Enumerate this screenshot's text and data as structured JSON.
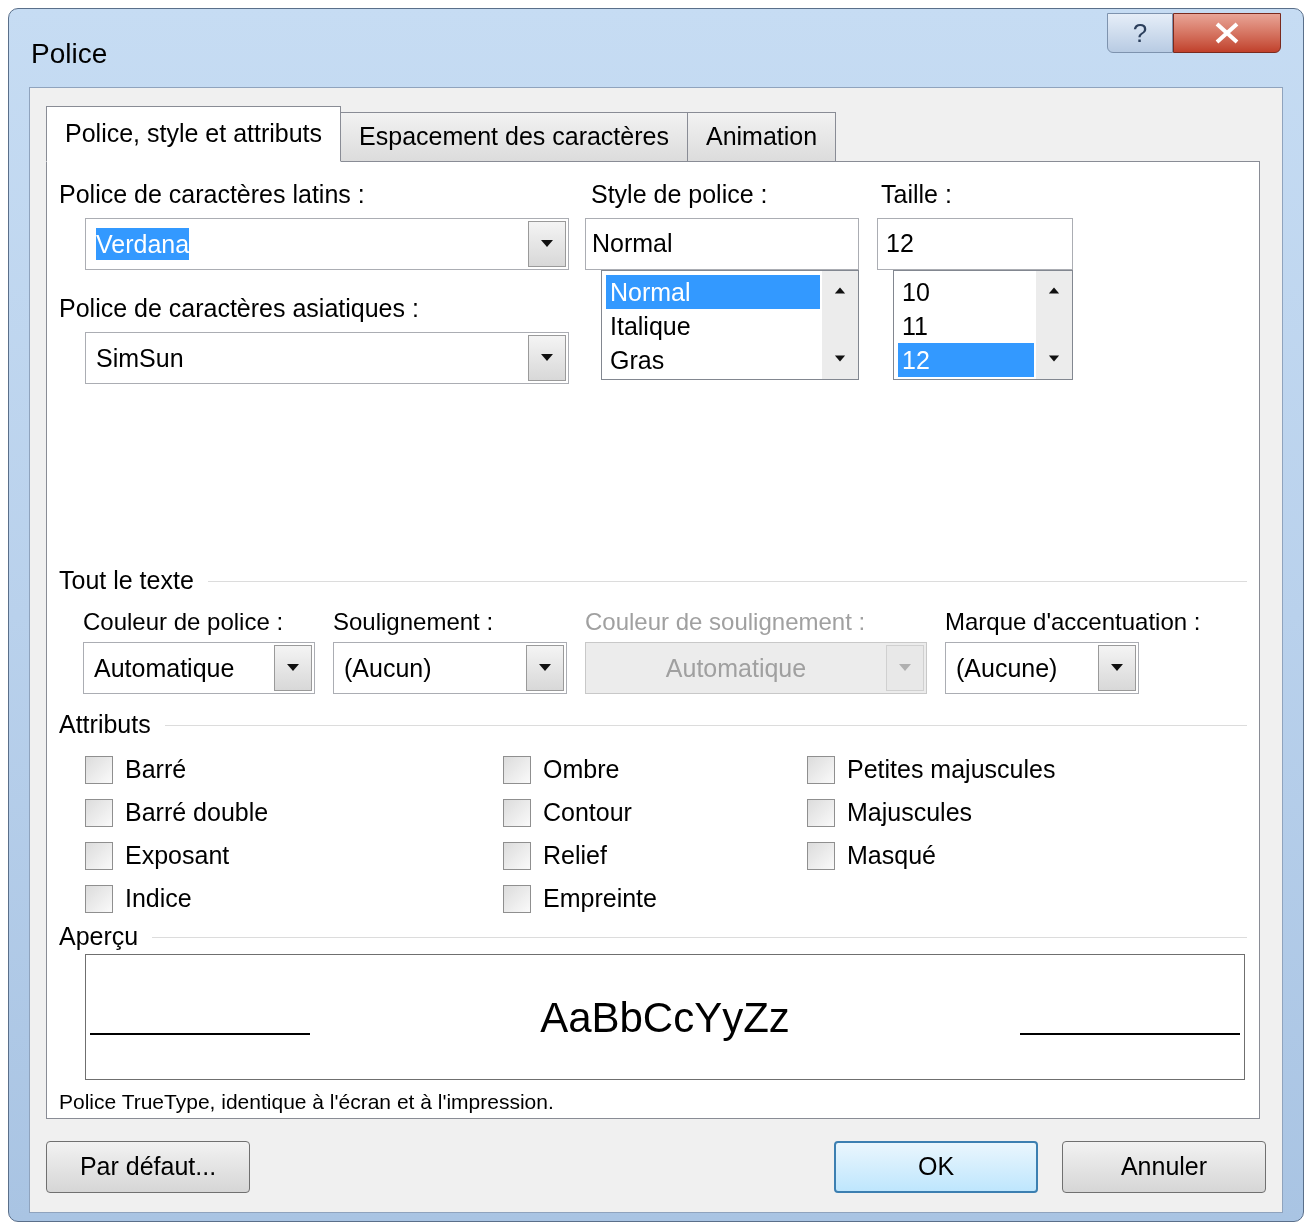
{
  "window": {
    "title": "Police",
    "help_label": "?"
  },
  "tabs": [
    {
      "label": "Police, style et attributs",
      "selected": true
    },
    {
      "label": "Espacement des caractères",
      "selected": false
    },
    {
      "label": "Animation",
      "selected": false
    }
  ],
  "latin_font": {
    "label": "Police de caractères latins :",
    "value": "Verdana",
    "highlighted": true
  },
  "asian_font": {
    "label": "Police de caractères asiatiques :",
    "value": "SimSun",
    "highlighted": false
  },
  "font_style": {
    "label": "Style de police :",
    "value": "Normal",
    "options": [
      {
        "label": "Normal",
        "selected": true
      },
      {
        "label": "Italique",
        "selected": false
      },
      {
        "label": "Gras",
        "selected": false
      }
    ]
  },
  "size": {
    "label": "Taille :",
    "value": "12",
    "options": [
      {
        "label": "10",
        "selected": false
      },
      {
        "label": "11",
        "selected": false
      },
      {
        "label": "12",
        "selected": true
      }
    ]
  },
  "all_text": {
    "title": "Tout le texte",
    "controls": [
      {
        "label": "Couleur de police :",
        "value": "Automatique",
        "disabled": false
      },
      {
        "label": "Soulignement :",
        "value": "(Aucun)",
        "disabled": false
      },
      {
        "label": "Couleur de soulignement :",
        "value": "Automatique",
        "disabled": true
      },
      {
        "label": "Marque d'accentuation :",
        "value": "(Aucune)",
        "disabled": false
      }
    ]
  },
  "attributes": {
    "title": "Attributs",
    "columns": [
      [
        {
          "label": "Barré",
          "checked": false
        },
        {
          "label": "Barré double",
          "checked": false
        },
        {
          "label": "Exposant",
          "checked": false
        },
        {
          "label": "Indice",
          "checked": false
        }
      ],
      [
        {
          "label": "Ombre",
          "checked": false
        },
        {
          "label": "Contour",
          "checked": false
        },
        {
          "label": "Relief",
          "checked": false
        },
        {
          "label": "Empreinte",
          "checked": false
        }
      ],
      [
        {
          "label": "Petites majuscules",
          "checked": false
        },
        {
          "label": "Majuscules",
          "checked": false
        },
        {
          "label": "Masqué",
          "checked": false
        }
      ]
    ]
  },
  "preview": {
    "title": "Aperçu",
    "sample": "AaBbCcYyZz",
    "note": "Police TrueType, identique à l'écran et à l'impression."
  },
  "buttons": [
    {
      "label": "Par défaut...",
      "default": false
    },
    {
      "label": "OK",
      "default": true
    },
    {
      "label": "Annuler",
      "default": false
    }
  ]
}
